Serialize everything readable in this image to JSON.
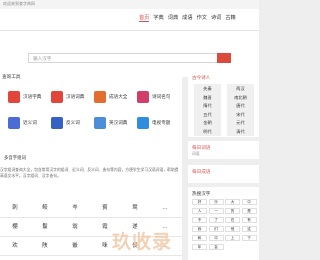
{
  "topbar": {
    "text": "欢迎来到查字典网"
  },
  "nav": {
    "items": [
      "首页",
      "字典",
      "词典",
      "成语",
      "作文",
      "诗词",
      "古籍"
    ],
    "active": 0
  },
  "search": {
    "placeholder": "输入汉字"
  },
  "tools_section": {
    "title": "查询工具",
    "items": [
      {
        "label": "汉语字典",
        "color": "#e2463a"
      },
      {
        "label": "汉语词典",
        "color": "#e2463a"
      },
      {
        "label": "成语大全",
        "color": "#e36c2f"
      },
      {
        "label": "诗词名句",
        "color": "#d23d69"
      },
      {
        "label": "近义词",
        "color": "#4a6cd4"
      },
      {
        "label": "反义词",
        "color": "#3561c7"
      },
      {
        "label": "英汉词典",
        "color": "#4c8ed8"
      },
      {
        "label": "电视专题",
        "color": "#2f8de0"
      }
    ]
  },
  "study": {
    "title": "多音字组词",
    "text": "汉字组词查询大全，包含常用汉字的组词、近义词、反义词、造句等内容，方便学生学习汉语词语，帮助提高语文水平。汉字组词、汉字造句。"
  },
  "chars": {
    "rows": [
      [
        "刺",
        "鲛",
        "岑",
        "賓",
        "鸳",
        "…"
      ],
      [
        "棚",
        "鬘",
        "翁",
        "霞",
        "遂",
        "…"
      ],
      [
        "欢",
        "陕",
        "嵌",
        "咪",
        "侯",
        "…"
      ]
    ]
  },
  "poets": {
    "title": "古今诗人",
    "items": [
      "先秦",
      "两汉",
      "魏晋",
      "南北朝",
      "隋代",
      "唐代",
      "五代",
      "宋代",
      "金朝",
      "元代",
      "明代",
      "清代"
    ]
  },
  "daily_word": {
    "title": "每日词语",
    "sub": "词语"
  },
  "daily_idiom": {
    "title": "每日成语"
  },
  "hot_tags": {
    "title": "热搜汉字",
    "items": [
      "好",
      "乐",
      "大",
      "中",
      "人",
      "一",
      "的",
      "是",
      "不",
      "了",
      "在",
      "有",
      "我",
      "们",
      "他",
      "这",
      "和",
      "中",
      "上",
      "下",
      "年",
      "会"
    ]
  },
  "watermark": "玖收录"
}
